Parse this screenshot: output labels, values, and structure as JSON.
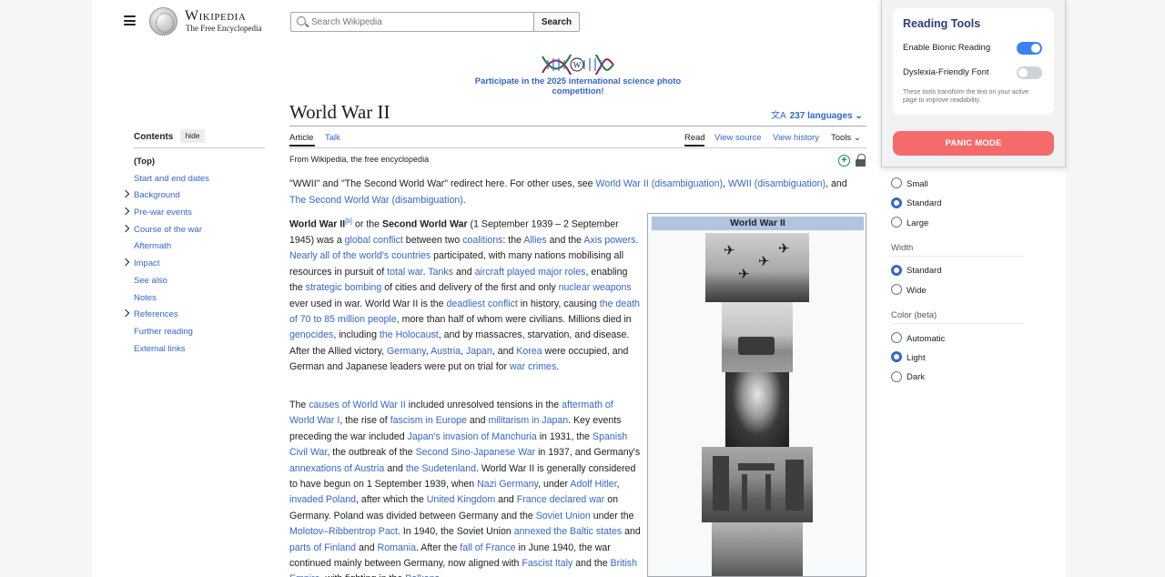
{
  "header": {
    "logo_word": "Wikipedia",
    "logo_tagline": "The Free Encyclopedia",
    "search_placeholder": "Search Wikipedia",
    "search_button": "Search"
  },
  "banner": {
    "text": "Participate in the 2025 international science photo competition!"
  },
  "toc": {
    "heading": "Contents",
    "hide_label": "hide",
    "items": [
      {
        "label": "(Top)",
        "expandable": false
      },
      {
        "label": "Start and end dates",
        "expandable": false
      },
      {
        "label": "Background",
        "expandable": true
      },
      {
        "label": "Pre-war events",
        "expandable": true
      },
      {
        "label": "Course of the war",
        "expandable": true
      },
      {
        "label": "Aftermath",
        "expandable": false
      },
      {
        "label": "Impact",
        "expandable": true
      },
      {
        "label": "See also",
        "expandable": false
      },
      {
        "label": "Notes",
        "expandable": false
      },
      {
        "label": "References",
        "expandable": true
      },
      {
        "label": "Further reading",
        "expandable": false
      },
      {
        "label": "External links",
        "expandable": false
      }
    ]
  },
  "article": {
    "title": "World War II",
    "languages": "237 languages",
    "tabs": {
      "article": "Article",
      "talk": "Talk",
      "read": "Read",
      "view_source": "View source",
      "view_history": "View history",
      "tools": "Tools"
    },
    "from": "From Wikipedia, the free encyclopedia",
    "hatnote": {
      "prefix": "\"WWII\" and \"The Second World War\" redirect here. For other uses, see ",
      "link1": "World War II (disambiguation)",
      "sep1": ", ",
      "link2": "WWII (disambiguation)",
      "sep2": ", and ",
      "link3": "The Second World War (disambiguation)",
      "suffix": "."
    },
    "infobox_title": "World War II"
  },
  "appearance": {
    "text_options": [
      "Small",
      "Standard",
      "Large"
    ],
    "width_label": "Width",
    "width_options": [
      "Standard",
      "Wide"
    ],
    "color_label": "Color (beta)",
    "color_options": [
      "Automatic",
      "Light",
      "Dark"
    ]
  },
  "reading_tools": {
    "title": "Reading Tools",
    "bionic_label": "Enable Bionic Reading",
    "bionic_on": true,
    "dyslexia_label": "Dyslexia-Friendly Font",
    "dyslexia_on": false,
    "note": "These tools transform the text on your active page to improve readability.",
    "panic_button": "PANIC MODE"
  }
}
